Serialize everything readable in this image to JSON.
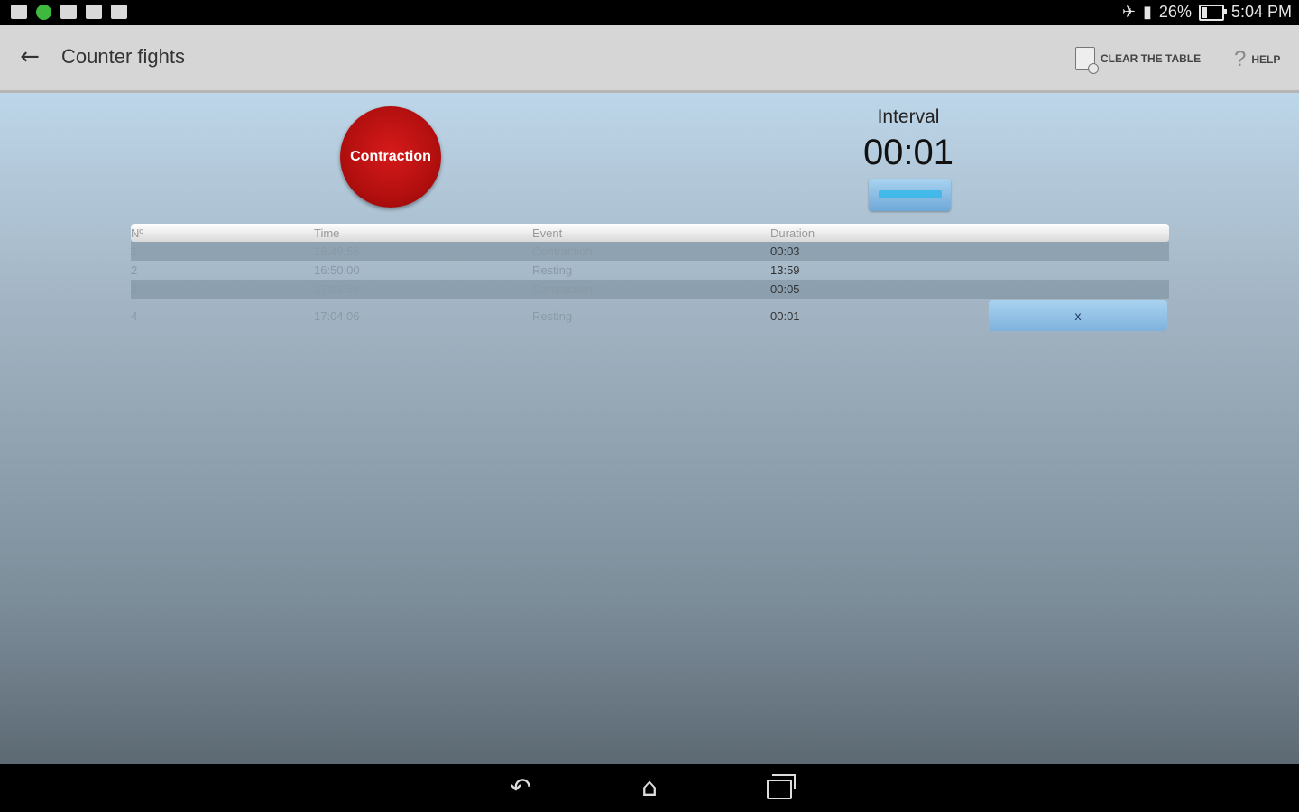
{
  "status_bar": {
    "icons": [
      "notes-icon",
      "green-dot-icon",
      "photo-icon",
      "app-icon",
      "app-icon-2"
    ],
    "battery_percent": "26%",
    "battery_level": 0.26,
    "time": "5:04 PM"
  },
  "action_bar": {
    "title": "Counter fights",
    "clear_label": "CLEAR THE TABLE",
    "help_label": "HELP"
  },
  "main": {
    "contraction_label": "Contraction",
    "interval_label": "Interval",
    "interval_value": "00:01"
  },
  "table": {
    "headers": {
      "n": "Nº",
      "time": "Time",
      "event": "Event",
      "duration": "Duration"
    },
    "rows": [
      {
        "n": "1",
        "time": "16:49:56",
        "event": "Contraction",
        "duration": "00:03"
      },
      {
        "n": "2",
        "time": "16:50:00",
        "event": "Resting",
        "duration": "13:59"
      },
      {
        "n": "3",
        "time": "17:03:59",
        "event": "Contraction",
        "duration": "00:05"
      },
      {
        "n": "4",
        "time": "17:04:06",
        "event": "Resting",
        "duration": "00:01"
      }
    ],
    "delete_label": "x"
  },
  "colors": {
    "accent_red": "#c41212",
    "button_blue": "#8fc0e6",
    "actionbar_bg": "#d6d6d6"
  }
}
